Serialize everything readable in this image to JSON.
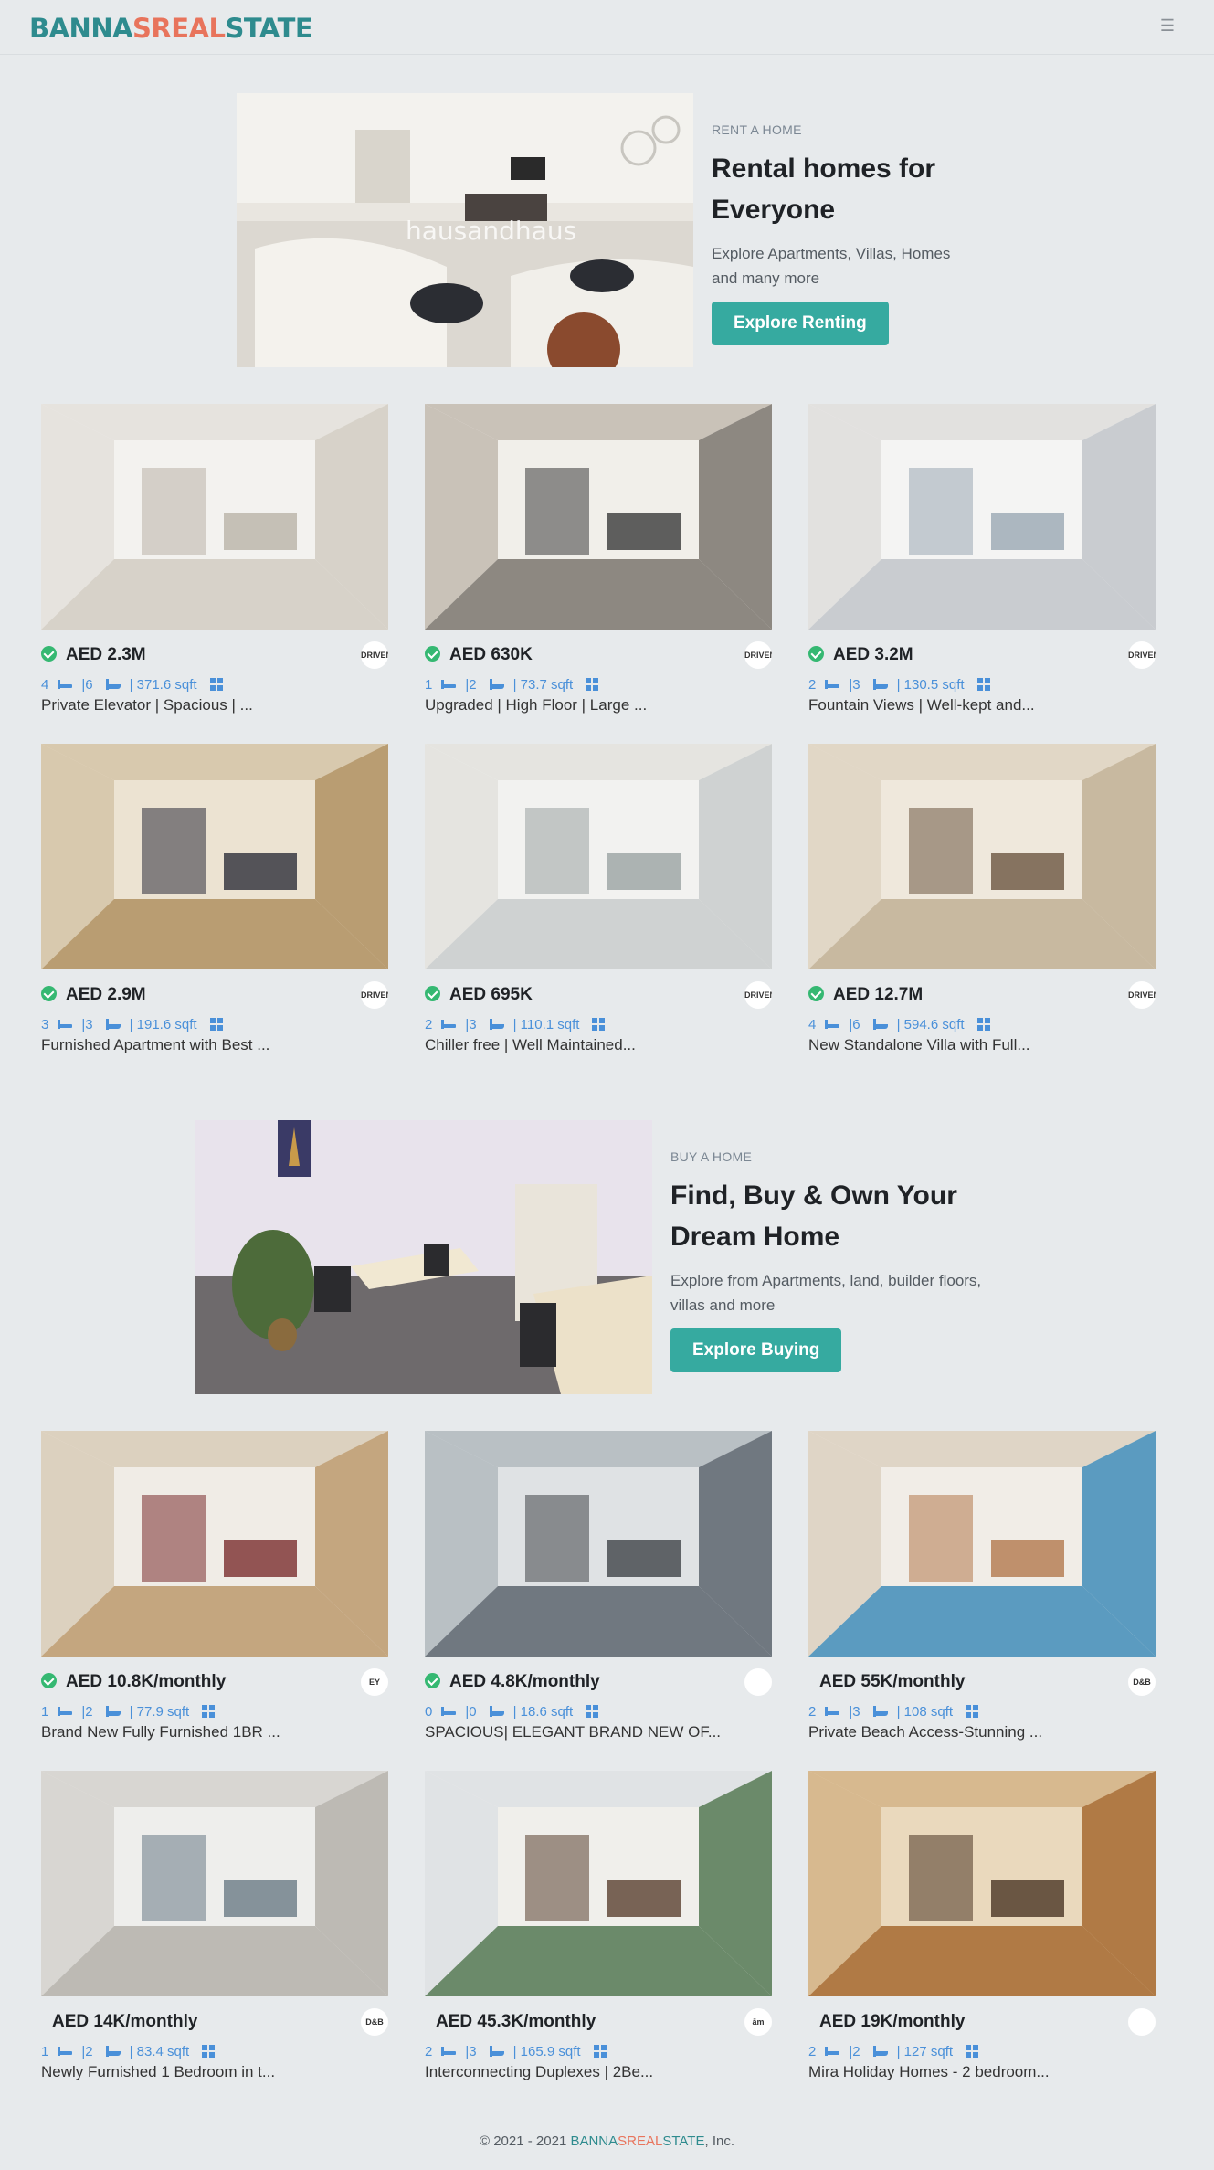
{
  "brand": {
    "part1": "BANNA",
    "part2": "SREAL",
    "part3": "STATE"
  },
  "header": {
    "menu_icon": "hamburger-icon"
  },
  "colors": {
    "accent": "#36aaa0",
    "brand_teal": "#2e8b8e",
    "brand_coral": "#e8745c",
    "meta_blue": "#4a90d9",
    "verified_green": "#35b872",
    "background": "#e7eaec"
  },
  "rent_hero": {
    "kicker": "RENT A HOME",
    "title_line1": "Rental homes for",
    "title_line2": "Everyone",
    "desc_line1": "Explore Apartments, Villas, Homes",
    "desc_line2": "and many more",
    "button": "Explore Renting",
    "image_watermark": "hausandhaus"
  },
  "buy_hero": {
    "kicker": "BUY A HOME",
    "title_line1": "Find, Buy & Own Your",
    "title_line2": "Dream Home",
    "desc_line1": "Explore from Apartments, land, builder floors,",
    "desc_line2": "villas and more",
    "button": "Explore Buying"
  },
  "sale_listings": [
    {
      "price": "AED 2.3M",
      "beds": "4",
      "baths": "6",
      "area": "| 371.6 sqft",
      "title": "Private Elevator | Spacious | ...",
      "verified": true,
      "agency": "DRIVEN"
    },
    {
      "price": "AED 630K",
      "beds": "1",
      "baths": "2",
      "area": "| 73.7 sqft",
      "title": "Upgraded | High Floor | Large ...",
      "verified": true,
      "agency": "DRIVEN"
    },
    {
      "price": "AED 3.2M",
      "beds": "2",
      "baths": "3",
      "area": "| 130.5 sqft",
      "title": "Fountain Views | Well-kept and...",
      "verified": true,
      "agency": "DRIVEN"
    },
    {
      "price": "AED 2.9M",
      "beds": "3",
      "baths": "3",
      "area": "| 191.6 sqft",
      "title": "Furnished Apartment with Best ...",
      "verified": true,
      "agency": "DRIVEN"
    },
    {
      "price": "AED 695K",
      "beds": "2",
      "baths": "3",
      "area": "| 110.1 sqft",
      "title": "Chiller free | Well Maintained...",
      "verified": true,
      "agency": "DRIVEN"
    },
    {
      "price": "AED 12.7M",
      "beds": "4",
      "baths": "6",
      "area": "| 594.6 sqft",
      "title": "New Standalone Villa with Full...",
      "verified": true,
      "agency": "DRIVEN"
    }
  ],
  "rent_listings": [
    {
      "price": "AED 10.8K/monthly",
      "beds": "1",
      "baths": "2",
      "area": "| 77.9 sqft",
      "title": "Brand New Fully Furnished 1BR ...",
      "verified": true,
      "agency": "EY"
    },
    {
      "price": "AED 4.8K/monthly",
      "beds": "0",
      "baths": "0",
      "area": "| 18.6 sqft",
      "title": "SPACIOUS| ELEGANT BRAND NEW OF...",
      "verified": true,
      "agency": ""
    },
    {
      "price": "AED 55K/monthly",
      "beds": "2",
      "baths": "3",
      "area": "| 108 sqft",
      "title": "Private Beach Access-Stunning ...",
      "verified": false,
      "agency": "D&B"
    },
    {
      "price": "AED 14K/monthly",
      "beds": "1",
      "baths": "2",
      "area": "| 83.4 sqft",
      "title": "Newly Furnished 1 Bedroom in t...",
      "verified": false,
      "agency": "D&B"
    },
    {
      "price": "AED 45.3K/monthly",
      "beds": "2",
      "baths": "3",
      "area": "| 165.9 sqft",
      "title": "Interconnecting Duplexes | 2Be...",
      "verified": false,
      "agency": "ām"
    },
    {
      "price": "AED 19K/monthly",
      "beds": "2",
      "baths": "2",
      "area": "| 127 sqft",
      "title": "Mira Holiday Homes - 2 bedroom...",
      "verified": false,
      "agency": ""
    }
  ],
  "footer": {
    "prefix": "© 2021 - 2021 ",
    "suffix": ", Inc."
  }
}
